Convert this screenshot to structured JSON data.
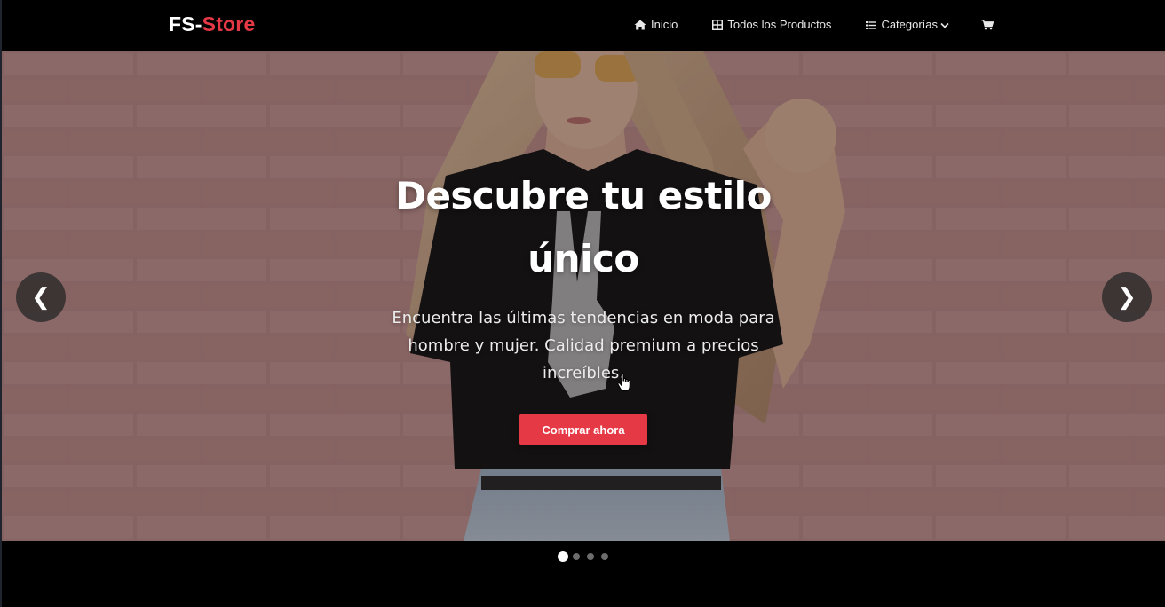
{
  "navbar": {
    "brand": {
      "part1": "FS-",
      "part2": "Store"
    },
    "links": [
      {
        "label": "Inicio",
        "icon": "home-icon"
      },
      {
        "label": "Todos los Productos",
        "icon": "grid-icon"
      },
      {
        "label": "Categorías",
        "icon": "list-icon",
        "dropdown": true
      },
      {
        "label": "",
        "icon": "cart-icon"
      }
    ]
  },
  "hero": {
    "title": "Descubre tu estilo único",
    "subtitle": "Encuentra las últimas tendencias en moda para hombre y mujer. Calidad premium a precios increíbles.",
    "cta_label": "Comprar ahora",
    "prev_arrow": "❮",
    "next_arrow": "❯",
    "image": "woman-black-tshirt-pink-brick-wall"
  },
  "carousel": {
    "slide_count": 4,
    "active_index": 0
  },
  "colors": {
    "accent": "#e63946",
    "navbar_bg": "#000000",
    "text_light": "#ffffff"
  }
}
